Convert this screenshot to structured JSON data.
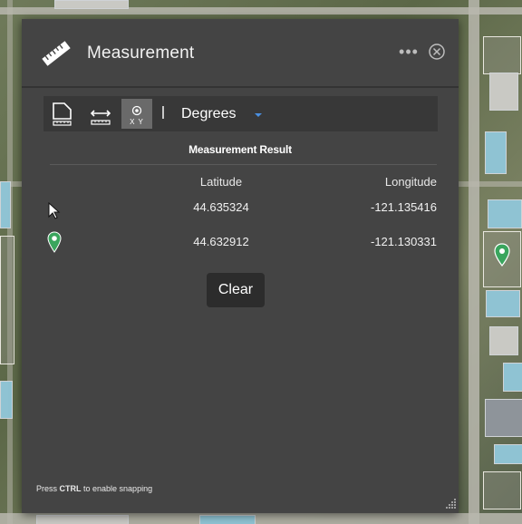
{
  "widget": {
    "title": "Measurement",
    "more_label": "•••"
  },
  "toolbar": {
    "tools": [
      {
        "icon": "area-measure-icon"
      },
      {
        "icon": "distance-measure-icon"
      },
      {
        "icon": "location-measure-icon",
        "label": "X Y",
        "selected": true
      }
    ],
    "unit": "Degrees"
  },
  "result": {
    "title": "Measurement Result",
    "columns": [
      "Latitude",
      "Longitude"
    ],
    "rows": [
      {
        "icon": "cursor-icon",
        "latitude": "44.635324",
        "longitude": "-121.135416"
      },
      {
        "icon": "pin-icon",
        "latitude": "44.632912",
        "longitude": "-121.130331"
      }
    ],
    "clear_label": "Clear"
  },
  "footer": {
    "prefix": "Press ",
    "key": "CTRL",
    "suffix": " to enable snapping"
  },
  "colors": {
    "panel_bg": "#444444",
    "toolbar_bg": "#383838",
    "pin_green": "#3aa55d",
    "accent_blue": "#4a90e2"
  }
}
